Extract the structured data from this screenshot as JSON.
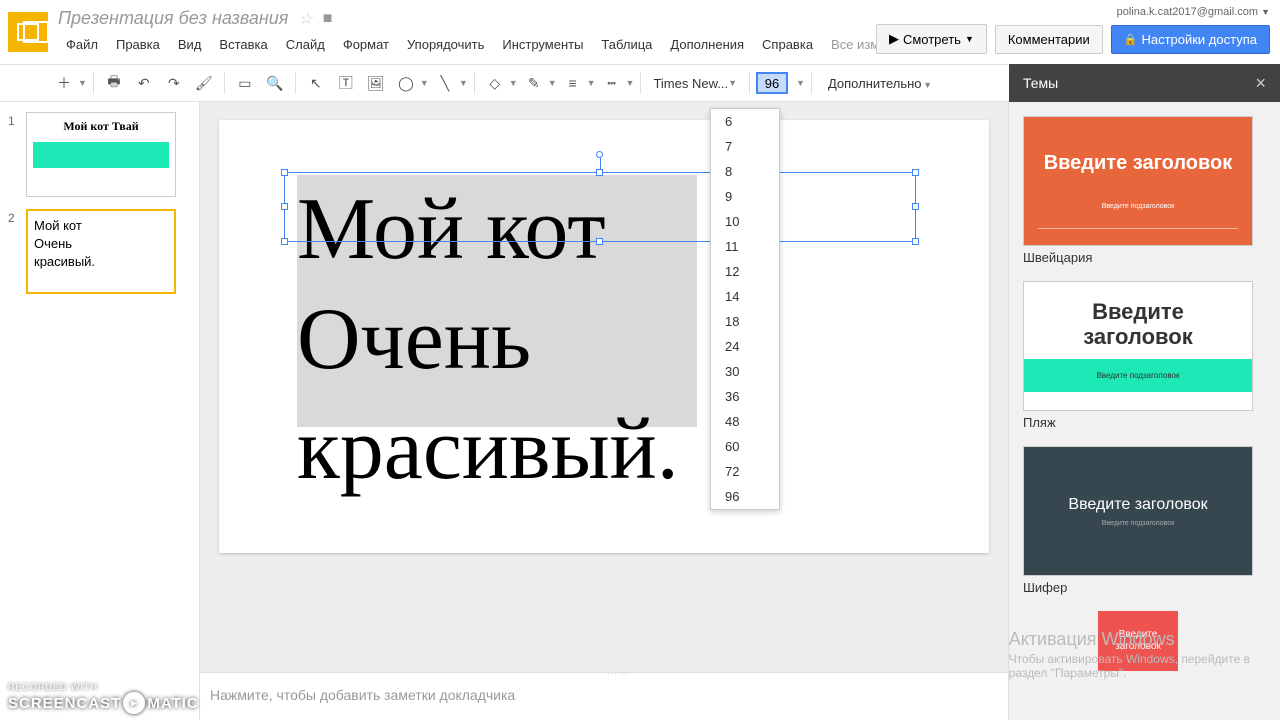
{
  "header": {
    "title": "Презентация без названия",
    "user_email": "polina.k.cat2017@gmail.com",
    "view_btn": "Смотреть",
    "comments_btn": "Комментарии",
    "share_btn": "Настройки доступа"
  },
  "menu": {
    "file": "Файл",
    "edit": "Правка",
    "view": "Вид",
    "insert": "Вставка",
    "slide": "Слайд",
    "format": "Формат",
    "arrange": "Упорядочить",
    "tools": "Инструменты",
    "table": "Таблица",
    "addons": "Дополнения",
    "help": "Справка",
    "saved": "Все изменения сохран..."
  },
  "toolbar": {
    "font_name": "Times New...",
    "font_size": "96",
    "more": "Дополнительно"
  },
  "font_sizes": [
    "6",
    "7",
    "8",
    "9",
    "10",
    "11",
    "12",
    "14",
    "18",
    "24",
    "30",
    "36",
    "48",
    "60",
    "72",
    "96"
  ],
  "thumbnails": [
    {
      "num": "1",
      "title": "Мой кот Твай"
    },
    {
      "num": "2",
      "line1": "Мой кот",
      "line2": "Очень",
      "line3": "красивый."
    }
  ],
  "slide_text": "Мой кот\nОчень\nкрасивый.",
  "notes_placeholder": "Нажмите, чтобы добавить заметки докладчика",
  "themes": {
    "title": "Темы",
    "placeholder_title": "Введите заголовок",
    "placeholder_title_multi": "Введите\nзаголовок",
    "placeholder_sub": "Введите подзаголовок",
    "items": [
      {
        "name": "Швейцария"
      },
      {
        "name": "Пляж"
      },
      {
        "name": "Шифер"
      }
    ]
  },
  "activation": {
    "title": "Активация Windows",
    "sub1": "Чтобы активировать Windows, перейдите в",
    "sub2": "раздел \"Параметры\"."
  },
  "watermark": {
    "top": "RECORDED WITH",
    "main1": "SCREENCAST",
    "main2": "MATIC"
  }
}
